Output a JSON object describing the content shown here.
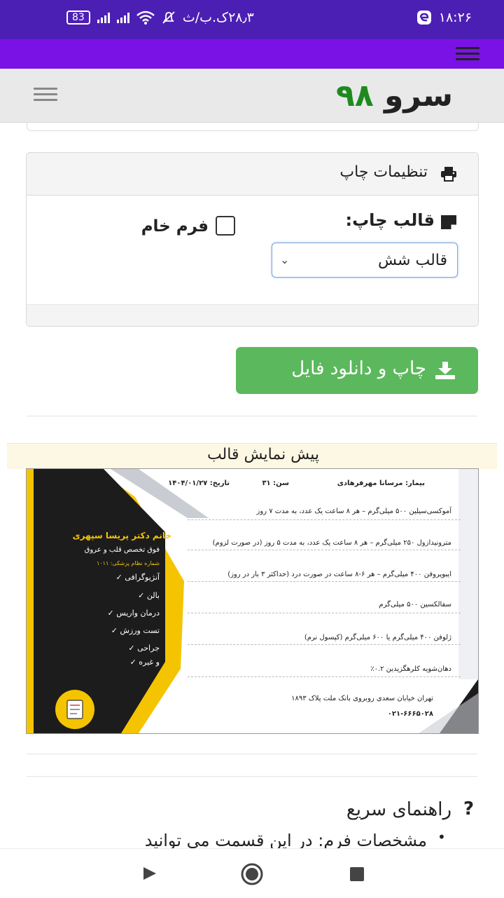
{
  "status_bar": {
    "time": "۱۸:۲۶",
    "carrier": "۲۸٫۳ک.ب/ث",
    "battery": "83"
  },
  "header": {
    "logo_word": "سرو",
    "logo_number": "۹۸"
  },
  "print_settings": {
    "title": "تنظیمات چاپ",
    "template_label": "قالب چاپ:",
    "template_selected": "قالب شش",
    "raw_form_label": "فرم خام",
    "raw_form_checked": false
  },
  "print_button": {
    "label": "چاپ و دانلود فایل"
  },
  "preview": {
    "title": "پیش نمایش قالب",
    "doctor_name": "خانم دکتر پریسا سپهری",
    "specialty": "فوق تخصص قلب و عروق",
    "license": "شماره نظام پزشکی: ۱۰۱۱",
    "services": [
      "آنژیوگرافی",
      "بالن",
      "درمان واریس",
      "تست ورزش",
      "جراحی",
      "و غیره"
    ],
    "patient": "بیمار: مرسانا مهرفرهادی",
    "age": "سن: ۳۱",
    "date": "تاریخ: ۱۴۰۴/۰۱/۲۷",
    "prescriptions": [
      "آموکسی‌سیلین ۵۰۰ میلی‌گرم – هر ۸ ساعت یک عدد، به مدت ۷ روز",
      "مترونیدازول ۲۵۰ میلی‌گرم – هر ۸ ساعت یک عدد، به مدت ۵ روز (در صورت لزوم)",
      "ایبوپروفن ۴۰۰ میلی‌گرم – هر ۶-۸ ساعت در صورت درد (حداکثر ۳ بار در روز)",
      "سفالکسین ۵۰۰ میلی‌گرم",
      "ژلوفن ۴۰۰ میلی‌گرم یا ۶۰۰ میلی‌گرم (کپسول نرم)",
      "دهان‌شویه کلرهگزیدین ۰.۲٪"
    ],
    "address": "تهران خیابان سعدی روبروی بانک ملت پلاک ۱۸۹۳",
    "phone": "۰۲۱-۶۶۶۵۰۲۸"
  },
  "guide": {
    "title": "راهنمای سریع",
    "first_item": "مشخصات فرم: در این قسمت می توانید"
  },
  "colors": {
    "status_bar": "#4c1fb4",
    "top_bar": "#7a12e6",
    "header_bg": "#e9e9e9",
    "logo_number": "#1e8a1e",
    "print_button": "#5cb85c",
    "preview_bar": "#fcf8e3",
    "template_yellow": "#f5c400"
  }
}
